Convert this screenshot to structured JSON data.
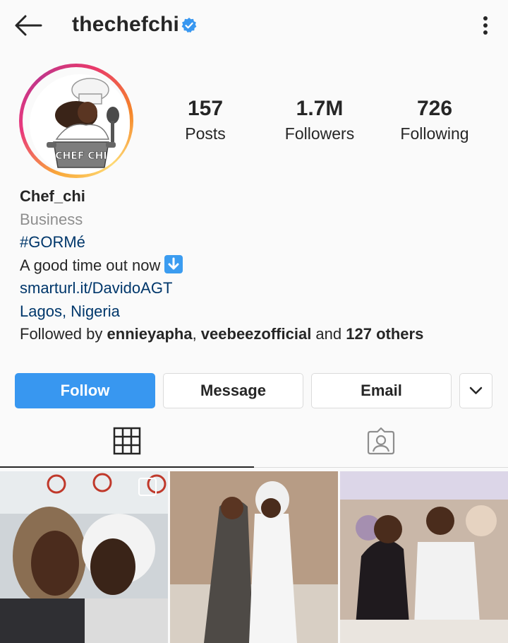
{
  "header": {
    "username": "thechefchi",
    "back_icon": "back-arrow-icon",
    "verified_icon": "verified-badge-icon",
    "more_icon": "more-vertical-icon"
  },
  "profile": {
    "avatar_text": "CHEF CHI"
  },
  "stats": [
    {
      "value": "157",
      "label": "Posts"
    },
    {
      "value": "1.7M",
      "label": "Followers"
    },
    {
      "value": "726",
      "label": "Following"
    }
  ],
  "bio": {
    "name": "Chef_chi",
    "category": "Business",
    "hashtag": "#GORMé",
    "line": "A good time out now",
    "link": "smarturl.it/DavidoAGT",
    "location": "Lagos, Nigeria",
    "followed_by_prefix": "Followed by ",
    "followed_by_user1": "ennieyapha",
    "followed_by_sep": ", ",
    "followed_by_user2": "veebeezofficial",
    "followed_by_and": " and ",
    "followed_by_others": "127 others"
  },
  "actions": {
    "follow": "Follow",
    "message": "Message",
    "email": "Email",
    "dropdown_icon": "chevron-down-icon"
  },
  "colors": {
    "follow_blue": "#3897f0",
    "link_blue": "#00376b",
    "verified_blue": "#3897f0"
  }
}
